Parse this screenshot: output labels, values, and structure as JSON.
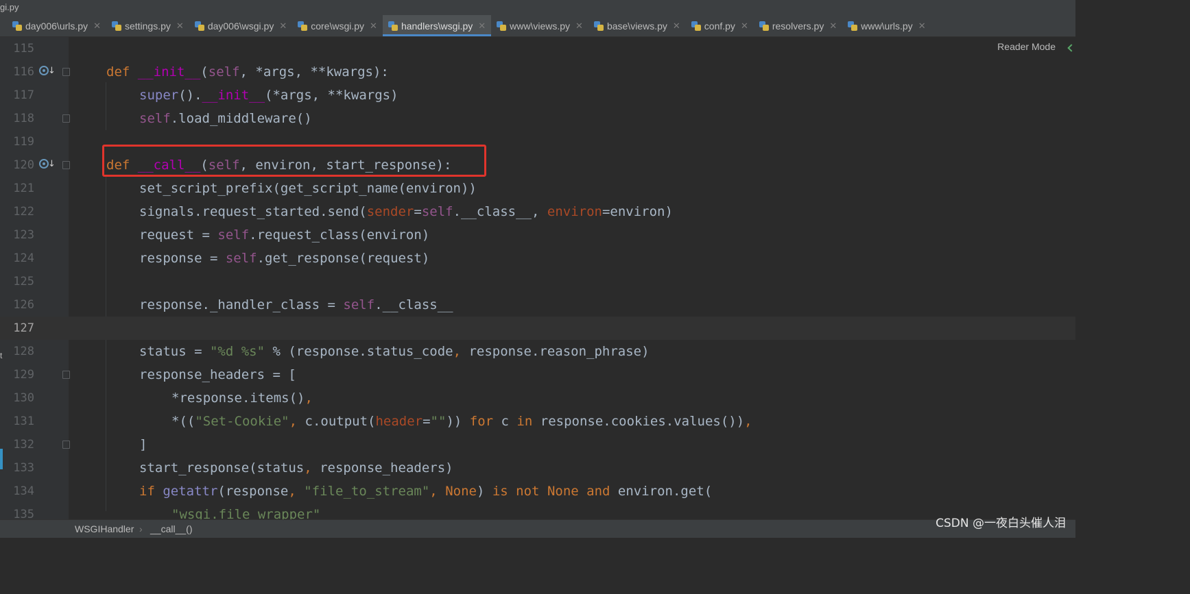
{
  "window": {
    "title": "gi.py"
  },
  "tabs": [
    {
      "label": "day006\\urls.py"
    },
    {
      "label": "settings.py"
    },
    {
      "label": "day006\\wsgi.py"
    },
    {
      "label": "core\\wsgi.py"
    },
    {
      "label": "handlers\\wsgi.py",
      "active": true
    },
    {
      "label": "www\\views.py"
    },
    {
      "label": "base\\views.py"
    },
    {
      "label": "conf.py"
    },
    {
      "label": "resolvers.py"
    },
    {
      "label": "www\\urls.py"
    }
  ],
  "editor": {
    "reader_mode": "Reader Mode",
    "current_line": "127",
    "lines": [
      {
        "no": "115"
      },
      {
        "no": "116"
      },
      {
        "no": "117"
      },
      {
        "no": "118"
      },
      {
        "no": "119"
      },
      {
        "no": "120"
      },
      {
        "no": "121"
      },
      {
        "no": "122"
      },
      {
        "no": "123"
      },
      {
        "no": "124"
      },
      {
        "no": "125"
      },
      {
        "no": "126"
      },
      {
        "no": "127"
      },
      {
        "no": "128"
      },
      {
        "no": "129"
      },
      {
        "no": "130"
      },
      {
        "no": "131"
      },
      {
        "no": "132"
      },
      {
        "no": "133"
      },
      {
        "no": "134"
      },
      {
        "no": "135"
      }
    ],
    "tokens": {
      "l116": [
        "def",
        " ",
        "__init__",
        "(",
        "self",
        ", *args, **kwargs):"
      ],
      "l117": [
        "super",
        "().",
        "__init__",
        "(*args, **kwargs)"
      ],
      "l118": [
        "self",
        ".load_middleware()"
      ],
      "l120": [
        "def",
        " ",
        "__call__",
        "(",
        "self",
        ", environ",
        ", ",
        "start_response):"
      ],
      "l121": [
        "set_script_prefix(get_script_name(environ))"
      ],
      "l122": [
        "signals.request_started.send(",
        "sender",
        "=",
        "self",
        ".__class__, ",
        "environ",
        "=environ)"
      ],
      "l123": [
        "request = ",
        "self",
        ".request_class(environ)"
      ],
      "l124": [
        "response = ",
        "self",
        ".get_response(request)"
      ],
      "l126": [
        "response._handler_class = ",
        "self",
        ".__class__"
      ],
      "l128": [
        "status = ",
        "\"%d %s\"",
        " % (response.status_code",
        ", ",
        "response.reason_phrase)"
      ],
      "l129": [
        "response_headers = ["
      ],
      "l130": [
        "*response.items()",
        ","
      ],
      "l131": [
        "*((",
        "\"Set-Cookie\"",
        ", ",
        "c.output(",
        "header",
        "=",
        "\"\"",
        ")) ",
        "for",
        " c ",
        "in",
        " response.cookies.values())",
        ","
      ],
      "l132": [
        "]"
      ],
      "l133": [
        "start_response(status",
        ", ",
        "response_headers)"
      ],
      "l134": [
        "if",
        " ",
        "getattr",
        "(response",
        ", ",
        "\"file_to_stream\"",
        ", ",
        "None",
        ") ",
        "is not",
        " ",
        "None",
        " ",
        "and",
        " environ.get("
      ],
      "l135": [
        "\"wsgi.file_wrapper\""
      ]
    }
  },
  "breadcrumbs": [
    "WSGIHandler",
    "__call__()"
  ],
  "breadcrumb_sep": "›",
  "watermark": "CSDN @一夜白头催人泪",
  "left_label": "t",
  "colors": {
    "keyword": "#cc7832",
    "dunder": "#b200b2",
    "self": "#94558d",
    "string": "#6a8759",
    "named_arg": "#aa4926",
    "builtin": "#8888c6",
    "highlight_box": "#e0342c",
    "active_tab_underline": "#4a88c7"
  }
}
